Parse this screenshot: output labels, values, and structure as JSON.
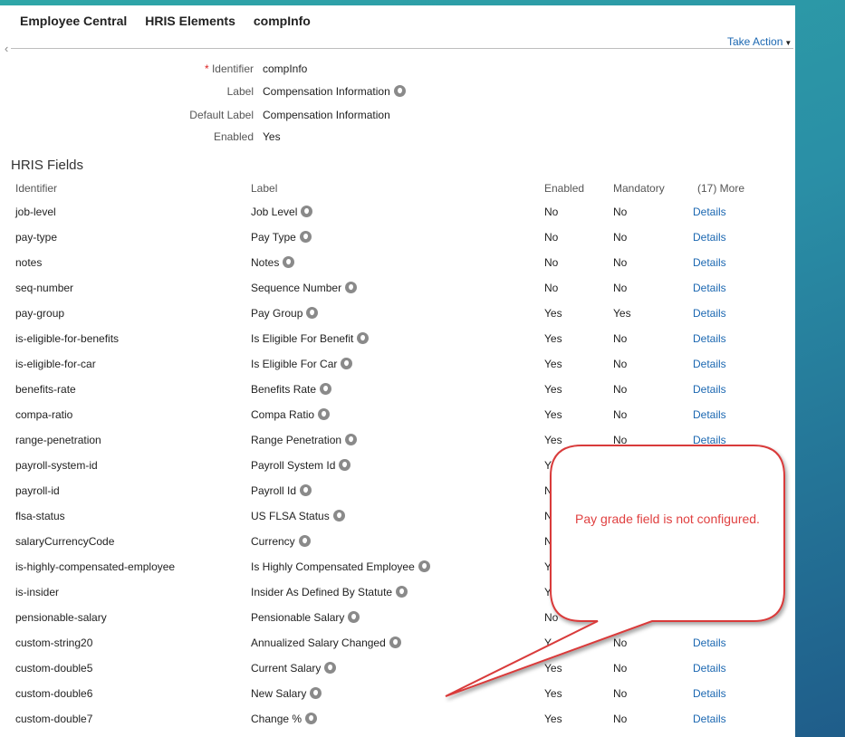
{
  "tabs": [
    "Employee Central",
    "HRIS Elements",
    "compInfo"
  ],
  "take_action": "Take Action",
  "info": {
    "identifier_label": "Identifier",
    "identifier_value": "compInfo",
    "label_label": "Label",
    "label_value": "Compensation Information",
    "default_label_label": "Default Label",
    "default_label_value": "Compensation Information",
    "enabled_label": "Enabled",
    "enabled_value": "Yes"
  },
  "section_title": "HRIS Fields",
  "columns": {
    "identifier": "Identifier",
    "label": "Label",
    "enabled": "Enabled",
    "mandatory": "Mandatory",
    "more": "(17) More"
  },
  "rows": [
    {
      "id": "job-level",
      "label": "Job Level",
      "enabled": "No",
      "mandatory": "No",
      "details": "Details"
    },
    {
      "id": "pay-type",
      "label": "Pay Type",
      "enabled": "No",
      "mandatory": "No",
      "details": "Details"
    },
    {
      "id": "notes",
      "label": "Notes",
      "enabled": "No",
      "mandatory": "No",
      "details": "Details"
    },
    {
      "id": "seq-number",
      "label": "Sequence Number",
      "enabled": "No",
      "mandatory": "No",
      "details": "Details"
    },
    {
      "id": "pay-group",
      "label": "Pay Group",
      "enabled": "Yes",
      "mandatory": "Yes",
      "details": "Details"
    },
    {
      "id": "is-eligible-for-benefits",
      "label": "Is Eligible For Benefit",
      "enabled": "Yes",
      "mandatory": "No",
      "details": "Details"
    },
    {
      "id": "is-eligible-for-car",
      "label": "Is Eligible For Car",
      "enabled": "Yes",
      "mandatory": "No",
      "details": "Details"
    },
    {
      "id": "benefits-rate",
      "label": "Benefits Rate",
      "enabled": "Yes",
      "mandatory": "No",
      "details": "Details"
    },
    {
      "id": "compa-ratio",
      "label": "Compa Ratio",
      "enabled": "Yes",
      "mandatory": "No",
      "details": "Details"
    },
    {
      "id": "range-penetration",
      "label": "Range Penetration",
      "enabled": "Yes",
      "mandatory": "No",
      "details": "Details"
    },
    {
      "id": "payroll-system-id",
      "label": "Payroll System Id",
      "enabled": "Yes",
      "mandatory": "",
      "details": ""
    },
    {
      "id": "payroll-id",
      "label": "Payroll Id",
      "enabled": "N",
      "mandatory": "",
      "details": ""
    },
    {
      "id": "flsa-status",
      "label": "US FLSA Status",
      "enabled": "N",
      "mandatory": "",
      "details": ""
    },
    {
      "id": "salaryCurrencyCode",
      "label": "Currency",
      "enabled": "N",
      "mandatory": "",
      "details": ""
    },
    {
      "id": "is-highly-compensated-employee",
      "label": "Is Highly Compensated Employee",
      "enabled": "Y",
      "mandatory": "",
      "details": ""
    },
    {
      "id": "is-insider",
      "label": "Insider As Defined By Statute",
      "enabled": "Y",
      "mandatory": "",
      "details": ""
    },
    {
      "id": "pensionable-salary",
      "label": "Pensionable Salary",
      "enabled": "No",
      "mandatory": "",
      "details": ""
    },
    {
      "id": "custom-string20",
      "label": "Annualized Salary Changed",
      "enabled": "Y",
      "mandatory": "No",
      "details": "Details"
    },
    {
      "id": "custom-double5",
      "label": "Current Salary",
      "enabled": "Yes",
      "mandatory": "No",
      "details": "Details"
    },
    {
      "id": "custom-double6",
      "label": "New Salary",
      "enabled": "Yes",
      "mandatory": "No",
      "details": "Details"
    },
    {
      "id": "custom-double7",
      "label": "Change %",
      "enabled": "Yes",
      "mandatory": "No",
      "details": "Details"
    }
  ],
  "callout": {
    "text": "Pay grade field is not configured.",
    "color": "#e04040"
  },
  "colors": {
    "link": "#1b67b1",
    "required": "#d22222"
  },
  "icons": {
    "translation": "globe-icon",
    "back": "back-arrow-icon",
    "dropdown": "caret-down-icon"
  }
}
